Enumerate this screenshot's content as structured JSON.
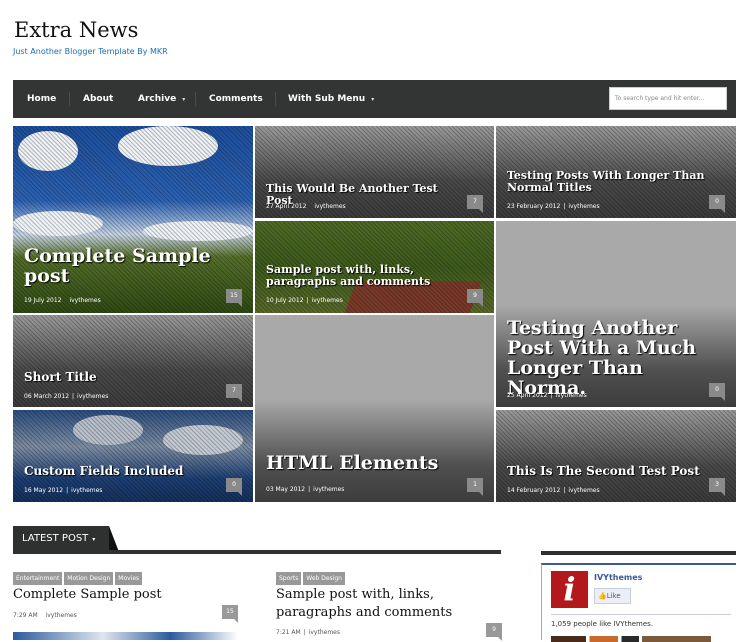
{
  "site": {
    "title": "Extra News",
    "tagline": "Just Another Blogger Template By MKR"
  },
  "nav": {
    "items": [
      {
        "label": "Home",
        "has_submenu": false
      },
      {
        "label": "About",
        "has_submenu": false
      },
      {
        "label": "Archive",
        "has_submenu": true
      },
      {
        "label": "Comments",
        "has_submenu": false
      },
      {
        "label": "With Sub Menu",
        "has_submenu": true
      }
    ],
    "submenu_arrow": "▾",
    "search_placeholder": "To search type and hit enter..."
  },
  "featured": [
    {
      "title": "Complete Sample post",
      "date": "19 July 2012",
      "author": "ivythemes",
      "comments": "15",
      "style": "sky"
    },
    {
      "title": "This Would Be Another Test Post",
      "date": "27 April 2012",
      "author": "ivythemes",
      "comments": "7",
      "style": "grey-dark"
    },
    {
      "title": "Testing Posts With Longer Than Normal Titles",
      "date": "23 February 2012",
      "author": "ivythemes",
      "comments": "0",
      "style": "grey-dark"
    },
    {
      "title": "Sample post with, links, paragraphs and comments",
      "date": "10 July 2012",
      "author": "ivythemes",
      "comments": "9",
      "style": "grass"
    },
    {
      "title": "Testing Another Post With a Much Longer Than Norma.",
      "date": "25 April 2012",
      "author": "ivythemes",
      "comments": "0",
      "style": "grey-light"
    },
    {
      "title": "Short Title",
      "date": "06 March 2012",
      "author": "ivythemes",
      "comments": "7",
      "style": "grey-dark"
    },
    {
      "title": "HTML Elements",
      "date": "03 May 2012",
      "author": "ivythemes",
      "comments": "1",
      "style": "grey-light"
    },
    {
      "title": "Custom Fields Included",
      "date": "16 May 2012",
      "author": "ivythemes",
      "comments": "0",
      "style": "clouds2"
    },
    {
      "title": "This Is The Second Test Post",
      "date": "14 February 2012",
      "author": "ivythemes",
      "comments": "3",
      "style": "grey-dark"
    }
  ],
  "latest": {
    "heading": "LATEST POST",
    "arrow": "▾",
    "posts": [
      {
        "tags": [
          "Entertainment",
          "Motion Design",
          "Movies"
        ],
        "title": "Complete Sample post",
        "time": "7:29 AM",
        "author": "ivythemes",
        "comments": "15"
      },
      {
        "tags": [
          "Sports",
          "Web Design"
        ],
        "title": "Sample post with, links, paragraphs and comments",
        "time": "7:21 AM",
        "author": "ivythemes",
        "comments": "9"
      }
    ]
  },
  "facebook": {
    "page_name": "IVYthemes",
    "logo_letter": "i",
    "like_label": "Like",
    "like_icon": "👍",
    "count_text": "1,059 people like IVYthemes."
  }
}
